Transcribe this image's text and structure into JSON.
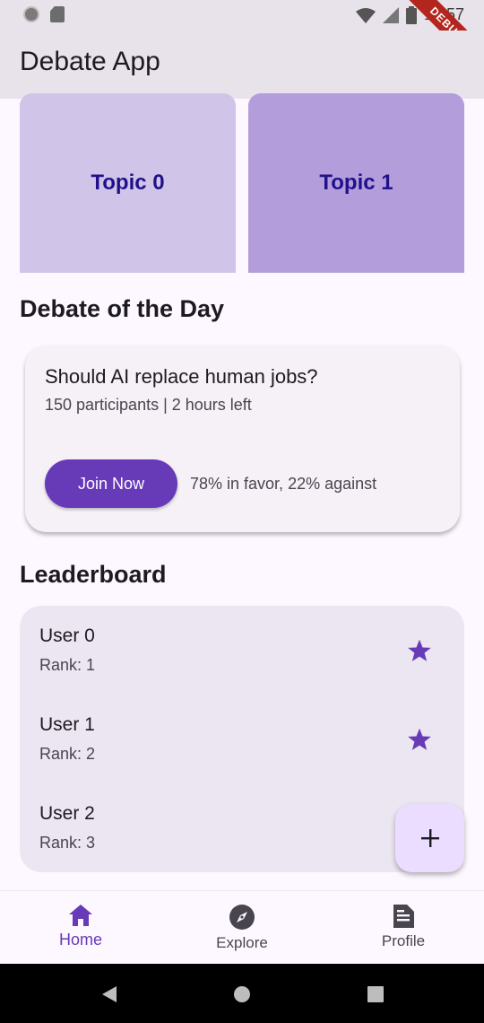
{
  "status_bar": {
    "time": "10:57",
    "debug_label": "DEBUG"
  },
  "app_bar": {
    "title": "Debate App"
  },
  "topics": [
    {
      "label": "Topic 0"
    },
    {
      "label": "Topic 1"
    }
  ],
  "debate_section": {
    "heading": "Debate of the Day",
    "question": "Should AI replace human jobs?",
    "meta": "150 participants | 2 hours left",
    "join_label": "Join Now",
    "vote_summary": "78% in favor, 22% against"
  },
  "leaderboard": {
    "heading": "Leaderboard",
    "users": [
      {
        "name": "User 0",
        "rank": "Rank: 1",
        "icon": "star-icon"
      },
      {
        "name": "User 1",
        "rank": "Rank: 2",
        "icon": "star-icon"
      },
      {
        "name": "User 2",
        "rank": "Rank: 3"
      }
    ]
  },
  "fab": {
    "icon": "plus-icon"
  },
  "bottom_nav": {
    "items": [
      {
        "label": "Home",
        "icon": "home-icon",
        "active": true
      },
      {
        "label": "Explore",
        "icon": "compass-icon",
        "active": false
      },
      {
        "label": "Profile",
        "icon": "document-icon",
        "active": false
      }
    ]
  },
  "colors": {
    "primary": "#673ab7",
    "topic_0_bg": "#d0c4e8",
    "topic_1_bg": "#b39ddb",
    "topic_text": "#21108a",
    "fab_bg": "#eaddff"
  }
}
